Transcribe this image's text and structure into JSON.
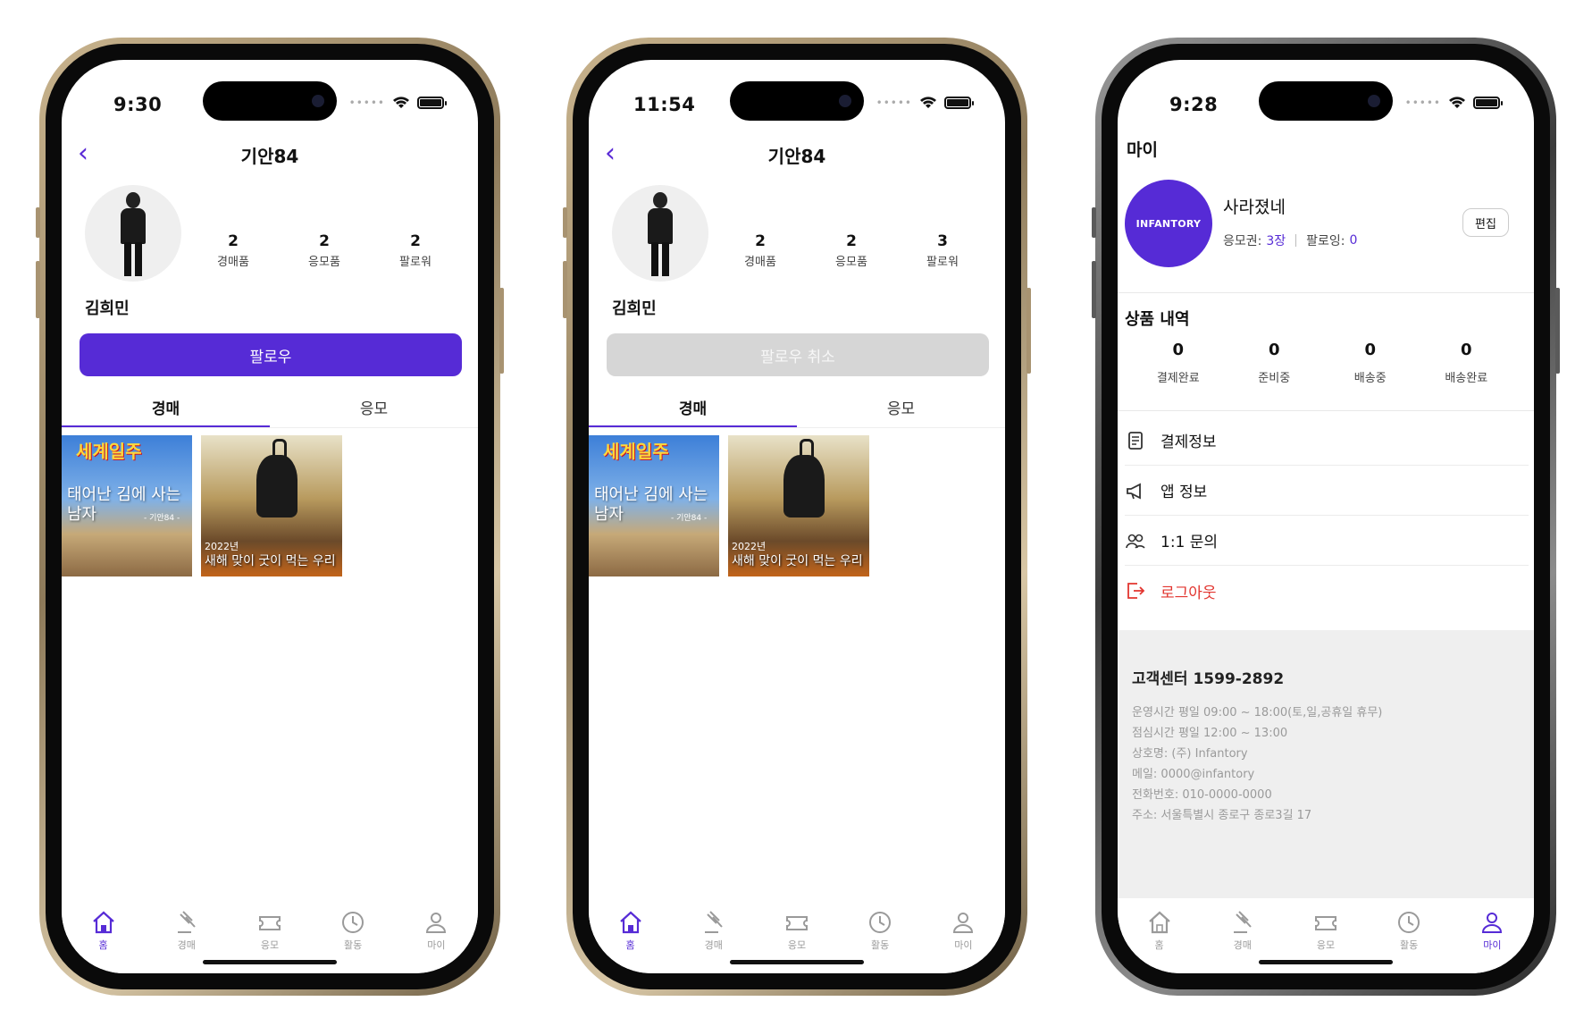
{
  "colors": {
    "accent": "#562bd6",
    "danger": "#e2352f",
    "disabled": "#d6d6d6"
  },
  "icons": [
    "back-chevron-icon",
    "wifi-icon",
    "battery-icon",
    "home-icon",
    "gavel-icon",
    "ticket-icon",
    "history-icon",
    "person-icon",
    "receipt-icon",
    "megaphone-icon",
    "people-icon",
    "logout-icon"
  ],
  "nav_labels": {
    "home": "홈",
    "auction": "경매",
    "entry": "응모",
    "activity": "활동",
    "my": "마이"
  },
  "thumbs": {
    "a_title": "세계일주",
    "a_sub": "태어난 김에 사는 남자",
    "a_credit": "- 기안84 -",
    "b_year": "2022년",
    "b_sub": "새해 맞이 굿이 먹는 우리"
  },
  "phone1": {
    "time": "9:30",
    "title": "기안84",
    "username": "김희민",
    "stats": [
      {
        "num": "2",
        "label": "경매품"
      },
      {
        "num": "2",
        "label": "응모품"
      },
      {
        "num": "2",
        "label": "팔로워"
      }
    ],
    "follow_label": "팔로우",
    "tabs": [
      "경매",
      "응모"
    ]
  },
  "phone2": {
    "time": "11:54",
    "title": "기안84",
    "username": "김희민",
    "stats": [
      {
        "num": "2",
        "label": "경매품"
      },
      {
        "num": "2",
        "label": "응모품"
      },
      {
        "num": "3",
        "label": "팔로워"
      }
    ],
    "follow_label": "팔로우 취소",
    "tabs": [
      "경매",
      "응모"
    ]
  },
  "phone3": {
    "time": "9:28",
    "title": "마이",
    "logo_text": "INFANTORY",
    "name": "사라졌네",
    "ticket_label": "응모권:",
    "ticket_value": "3장",
    "following_label": "팔로잉:",
    "following_value": "0",
    "edit_label": "편집",
    "orders_title": "상품 내역",
    "orders": [
      {
        "num": "0",
        "label": "결제완료"
      },
      {
        "num": "0",
        "label": "준비중"
      },
      {
        "num": "0",
        "label": "배송중"
      },
      {
        "num": "0",
        "label": "배송완료"
      }
    ],
    "menu": [
      "결제정보",
      "앱 정보",
      "1:1 문의",
      "로그아웃"
    ],
    "footer_title": "고객센터 1599-2892",
    "footer_lines": [
      "운영시간 평일 09:00 ~ 18:00(토,일,공휴일 휴무)",
      "점심시간 평일 12:00 ~ 13:00",
      "상호명: (주) Infantory",
      "메일: 0000@infantory",
      "전화번호: 010-0000-0000",
      "주소: 서울특별시 종로구 종로3길 17"
    ]
  }
}
